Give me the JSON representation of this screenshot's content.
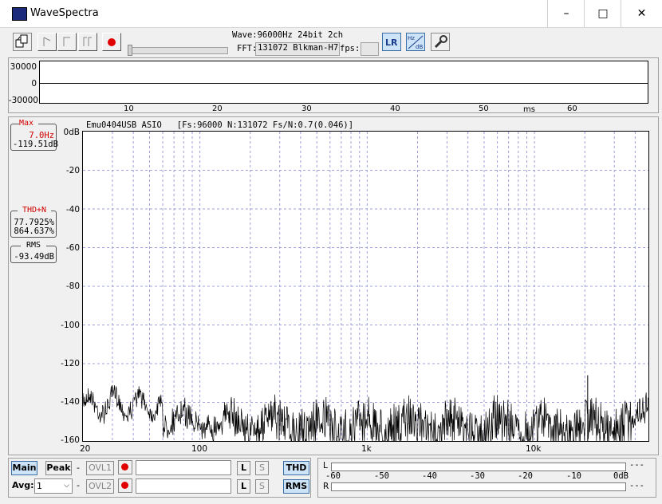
{
  "window": {
    "title": "WaveSpectra",
    "minimize": "–",
    "maximize": "□",
    "close": "✕"
  },
  "toolbar": {
    "wave_info": "Wave:96000Hz 24bit 2ch",
    "fft_label": "FFT:",
    "fft_info": "131072 Blkman-H7",
    "fps_label": "fps:",
    "fps_value": "",
    "lr_label": "L R",
    "hzdb_label": "Hz dB"
  },
  "waveform": {
    "y_labels": [
      "30000",
      "0",
      "-30000"
    ],
    "x_labels": [
      "10",
      "20",
      "30",
      "40",
      "50",
      "60"
    ],
    "x_unit": "ms"
  },
  "spectrum": {
    "header": "Emu0404USB ASIO   [Fs:96000 N:131072 Fs/N:0.7(0.046)]",
    "y_labels": [
      "0dB",
      "-20",
      "-40",
      "-60",
      "-80",
      "-100",
      "-120",
      "-140",
      "-160"
    ],
    "x_labels": [
      "20",
      "100",
      "1k",
      "10k"
    ],
    "max_title": "Max",
    "max_freq": "7.0Hz",
    "max_level": "-119.51dB",
    "thd_title": "THD+N",
    "thd_value1": "77.7925%",
    "thd_value2": "864.637%",
    "rms_title": "RMS",
    "rms_value": "-93.49dB"
  },
  "bottom": {
    "main_label": "Main",
    "peak_label": "Peak",
    "avg_label": "Avg:",
    "avg_value": "1",
    "dash1": "-",
    "dash2": "-",
    "ovl1_label": "OVL1",
    "ovl2_label": "OVL2",
    "l1_label": "L",
    "s1_label": "S",
    "l2_label": "L",
    "s2_label": "S",
    "thd_button": "THD",
    "rms_button": "RMS"
  },
  "meter": {
    "l_label": "L",
    "r_label": "R",
    "scale": [
      "-60",
      "-50",
      "-40",
      "-30",
      "-20",
      "-10",
      "0dB"
    ],
    "l_readout": "---",
    "r_readout": "---"
  },
  "colors": {
    "accent_red": "#d00000",
    "grid": "#9fa0d8",
    "button_on": "#cde3f7"
  }
}
